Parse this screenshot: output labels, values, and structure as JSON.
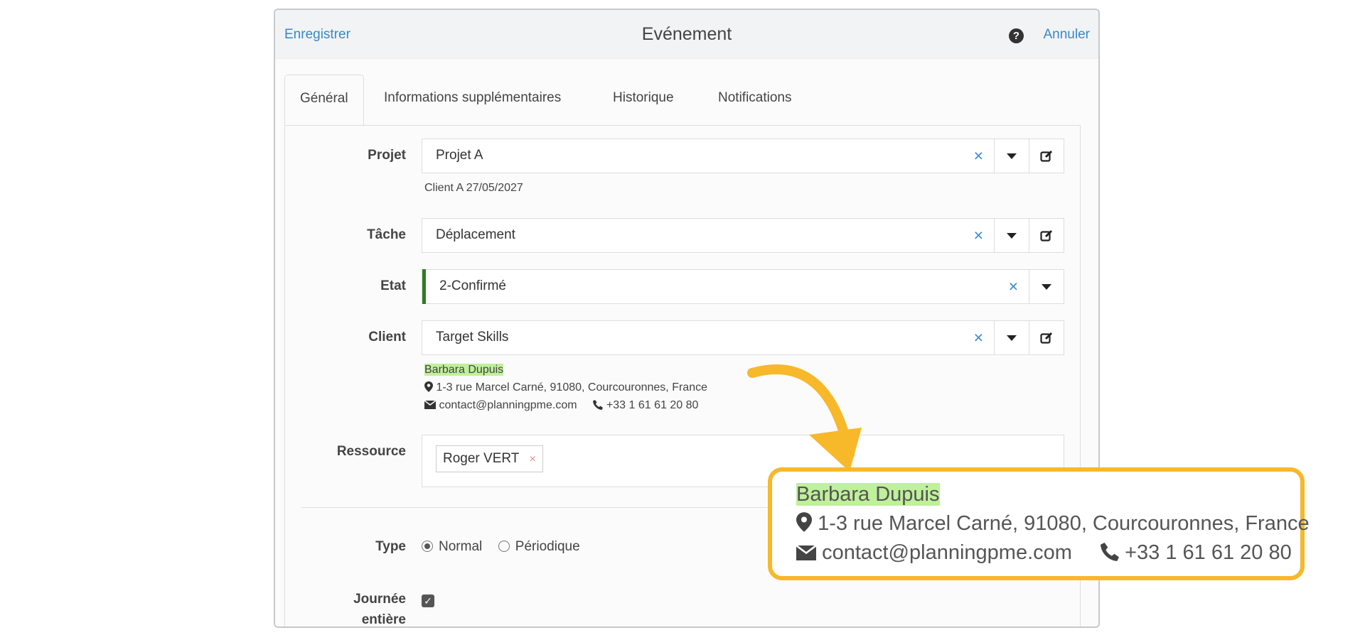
{
  "header": {
    "save_label": "Enregistrer",
    "title": "Evénement",
    "help_glyph": "?",
    "cancel_label": "Annuler"
  },
  "tabs": [
    {
      "label": "Général",
      "active": true
    },
    {
      "label": "Informations supplémentaires",
      "active": false
    },
    {
      "label": "Historique",
      "active": false
    },
    {
      "label": "Notifications",
      "active": false
    }
  ],
  "form": {
    "projet": {
      "label": "Projet",
      "value": "Projet A",
      "sub": "Client A 27/05/2027"
    },
    "tache": {
      "label": "Tâche",
      "value": "Déplacement"
    },
    "etat": {
      "label": "Etat",
      "value": "2-Confirmé",
      "color": "#2e7d1f"
    },
    "client": {
      "label": "Client",
      "value": "Target Skills",
      "contact_name": "Barbara Dupuis",
      "address": "1-3 rue Marcel Carné, 91080, Courcouronnes, France",
      "email": "contact@planningpme.com",
      "phone": "+33 1 61 61 20 80"
    },
    "ressource": {
      "label": "Ressource",
      "tag": "Roger VERT",
      "tag_remove": "×"
    },
    "type": {
      "label": "Type",
      "options": [
        "Normal",
        "Périodique"
      ],
      "selected": "Normal"
    },
    "journee": {
      "label_line1": "Journée",
      "label_line2": "entière",
      "checked": true
    }
  },
  "icons": {
    "clear": "×",
    "check": "✓"
  },
  "colors": {
    "link": "#3a87c8",
    "highlight": "#bff09a",
    "callout": "#f7b829"
  },
  "callout": {
    "contact_name": "Barbara Dupuis",
    "address": "1-3 rue Marcel Carné, 91080, Courcouronnes, France",
    "email": "contact@planningpme.com",
    "phone": "+33 1 61 61 20 80"
  }
}
